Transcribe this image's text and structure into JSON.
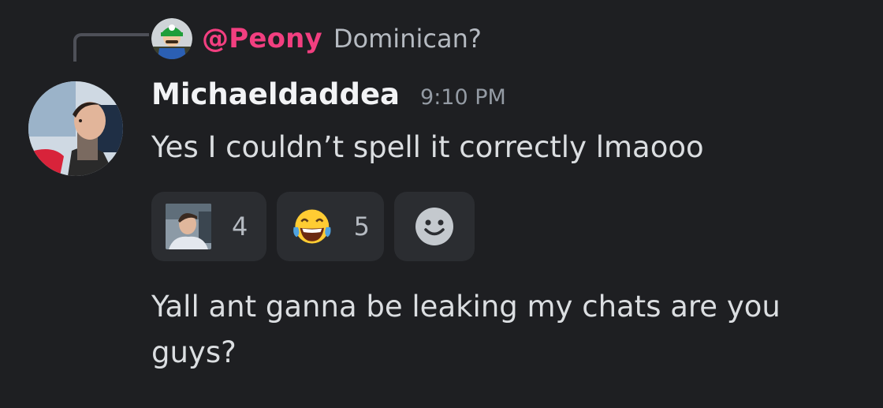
{
  "reply": {
    "author": "@Peony",
    "text": "Dominican?",
    "author_color": "#f23f80"
  },
  "message": {
    "username": "Michaeldaddea",
    "timestamp": "9:10 PM",
    "lines": [
      "Yes I couldn’t spell it correctly lmaooo",
      "Yall ant ganna be leaking my chats are you guys?"
    ]
  },
  "reactions": [
    {
      "emoji": "custom-photo-emoji",
      "count": "4"
    },
    {
      "emoji": "joy-tears-emoji",
      "count": "5"
    },
    {
      "emoji": "add-reaction-smiley-icon",
      "count": ""
    }
  ],
  "colors": {
    "background": "#1e1f22",
    "reaction_bg": "#2b2d31",
    "text": "#dbdee1",
    "muted": "#949ba4"
  }
}
